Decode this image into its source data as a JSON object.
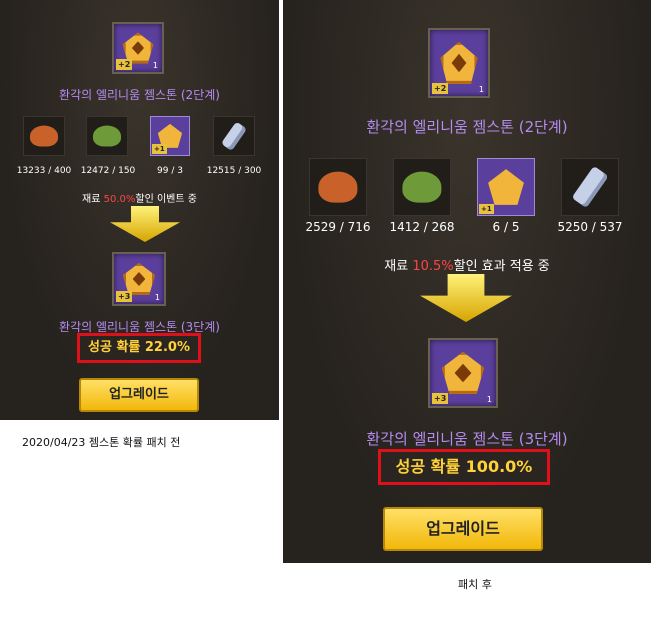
{
  "before": {
    "caption": "2020/04/23 젬스톤 확률 패치 전",
    "source_gem": {
      "badge": "+2",
      "count": "1"
    },
    "source_title": "환각의 엘리니움 젬스톤 (2단계)",
    "materials": [
      {
        "icon": "mushroom-food-orange-icon",
        "qty": "13233 / 400"
      },
      {
        "icon": "mushroom-food-green-icon",
        "qty": "12472 / 150"
      },
      {
        "icon": "gemstone-icon",
        "badge": "+1",
        "qty": "99 / 3"
      },
      {
        "icon": "crystal-icon",
        "qty": "12515 / 300"
      }
    ],
    "note_prefix": "재료 ",
    "note_percent": "50.0%",
    "note_suffix": "할인 이벤트 중",
    "result_gem": {
      "badge": "+3",
      "count": "1"
    },
    "result_title": "환각의 엘리니움 젬스톤 (3단계)",
    "chance": "성공 확률 22.0%",
    "button": "업그레이드"
  },
  "after": {
    "caption": "패치 후",
    "source_gem": {
      "badge": "+2",
      "count": "1"
    },
    "source_title": "환각의 엘리니움 젬스톤 (2단계)",
    "materials": [
      {
        "icon": "mushroom-food-orange-icon",
        "qty": "2529 / 716"
      },
      {
        "icon": "mushroom-food-green-icon",
        "qty": "1412 / 268"
      },
      {
        "icon": "gemstone-icon",
        "badge": "+1",
        "qty": "6 / 5"
      },
      {
        "icon": "crystal-icon",
        "qty": "5250 / 537"
      }
    ],
    "note_prefix": "재료 ",
    "note_percent": "10.5%",
    "note_suffix": "할인 효과 적용 중",
    "result_gem": {
      "badge": "+3",
      "count": "1"
    },
    "result_title": "환각의 엘리니움 젬스톤 (3단계)",
    "chance": "성공 확률 100.0%",
    "button": "업그레이드"
  },
  "colors": {
    "accent_purple": "#b58bf0",
    "highlight_red": "#e0101a",
    "chance_gold": "#ffd23a",
    "button_gold": "#f2b80a"
  }
}
